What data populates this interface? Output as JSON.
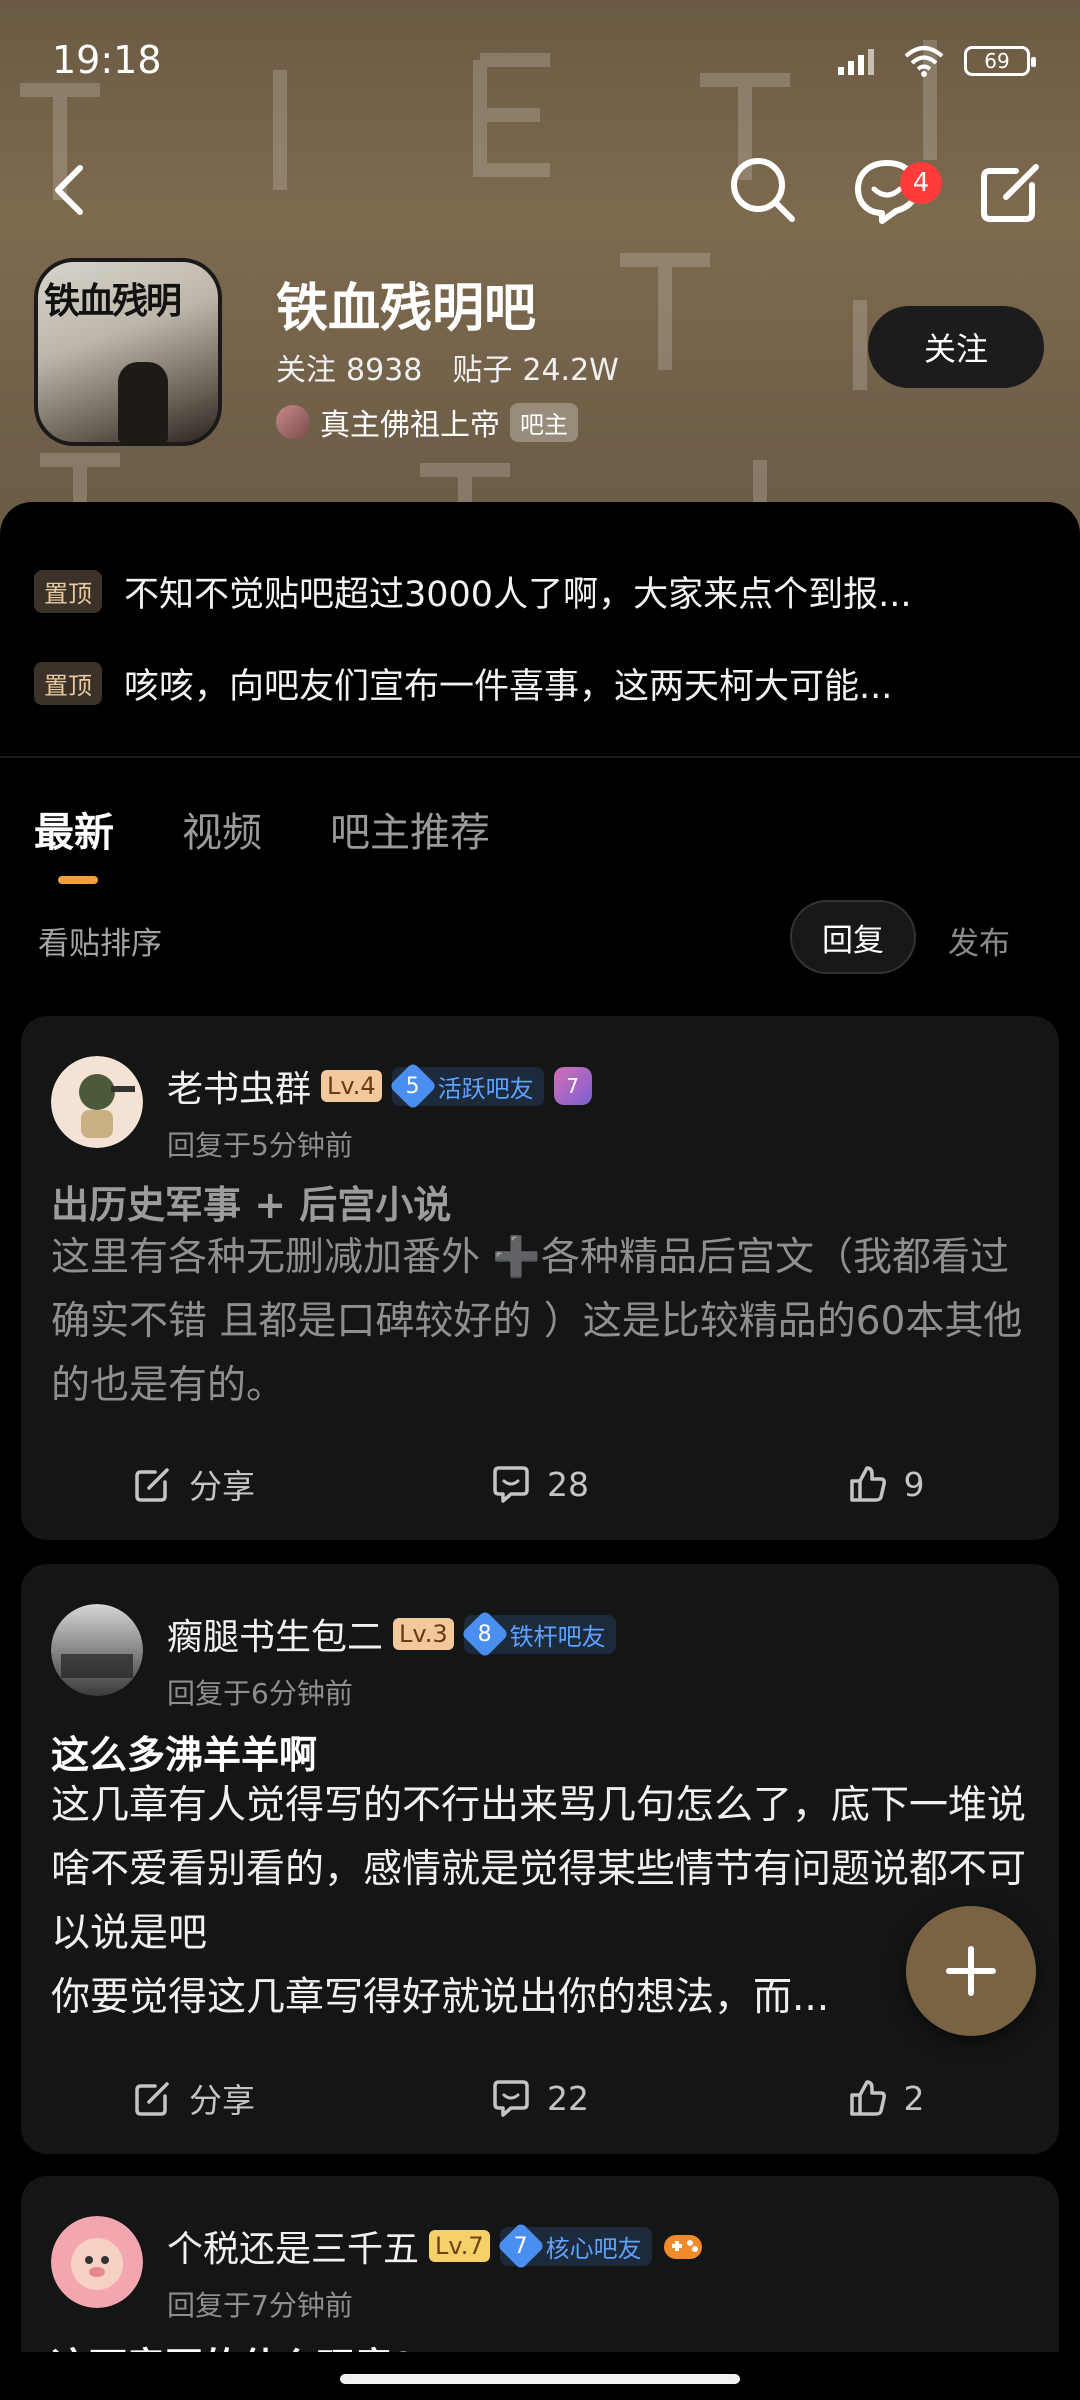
{
  "status": {
    "time": "19:18",
    "battery": "69"
  },
  "nav": {
    "message_count": "4"
  },
  "forum": {
    "avatar_text": "铁血残明",
    "name": "铁血残明吧",
    "follow_label": "关注",
    "follow_count": "8938",
    "post_label": "贴子",
    "post_count": "24.2W",
    "owner_name": "真主佛祖上帝",
    "owner_tag": "吧主",
    "follow_button": "关注"
  },
  "pinned": [
    {
      "tag": "置顶",
      "text": "不知不觉贴吧超过3000人了啊，大家来点个到报..."
    },
    {
      "tag": "置顶",
      "text": "咳咳，向吧友们宣布一件喜事，这两天柯大可能..."
    }
  ],
  "tabs": [
    "最新",
    "视频",
    "吧主推荐"
  ],
  "sort": {
    "label": "看贴排序",
    "active": "回复",
    "alt": "发布"
  },
  "posts": [
    {
      "user": "老书虫群",
      "level": "Lv.4",
      "fan_level": "5",
      "fan_title": "活跃吧友",
      "medal": "7",
      "time": "回复于5分钟前",
      "title": "出历史军事 + 后宫小说",
      "body": "这里有各种无删减加番外 ➕各种精品后宫文（我都看过确实不错 且都是口碑较好的 ）这是比较精品的60本其他的也是有的。",
      "share": "分享",
      "comments": "28",
      "likes": "9"
    },
    {
      "user": "瘸腿书生包二",
      "level": "Lv.3",
      "fan_level": "8",
      "fan_title": "铁杆吧友",
      "time": "回复于6分钟前",
      "title": "这么多沸羊羊啊",
      "body": "这几章有人觉得写的不行出来骂几句怎么了，底下一堆说啥不爱看别看的，感情就是觉得某些情节有问题说都不可以说是吧\n你要觉得这几章写得好就说出你的想法，而...",
      "share": "分享",
      "comments": "22",
      "likes": "2"
    },
    {
      "user": "个税还是三千五",
      "level": "Lv.7",
      "fan_level": "7",
      "fan_title": "核心吧友",
      "time": "回复于7分钟前",
      "title": "这两章写的什么玩意?"
    }
  ],
  "colors": {
    "accent": "#f29f3c",
    "fan_blue": "#5ea2ff",
    "badge_red": "#ff3b3b"
  }
}
